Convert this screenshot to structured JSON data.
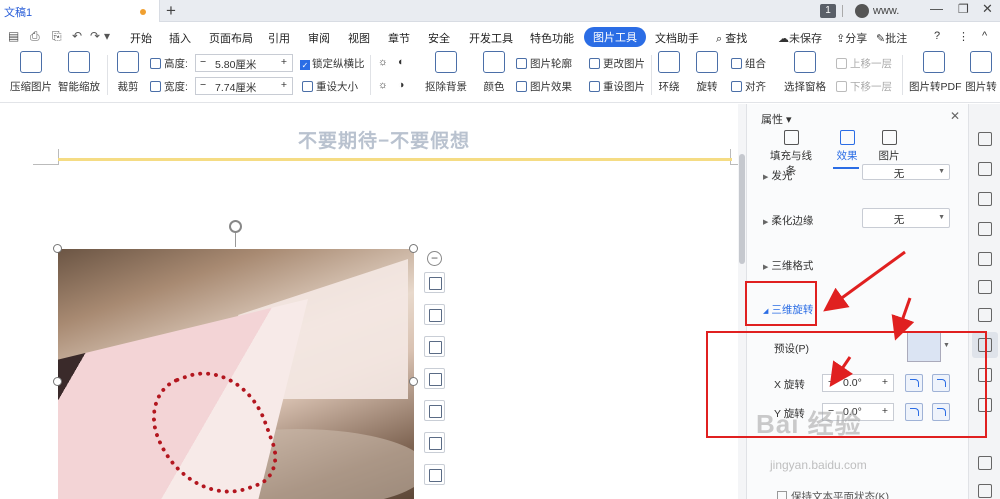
{
  "tabbar": {
    "doc_name": "文稿1",
    "new_tab": "+",
    "page_count": "1",
    "user_name": "www.",
    "win_min": "—",
    "win_max": "❐",
    "win_close": "✕"
  },
  "menubar": {
    "quick_access": [
      "▤",
      "⎙",
      "⎘",
      "↶",
      "↷",
      "▾"
    ],
    "items": [
      "开始",
      "插入",
      "页面布局",
      "引用",
      "审阅",
      "视图",
      "章节",
      "安全",
      "开发工具",
      "特色功能",
      "图片工具",
      "文档助手",
      "查找"
    ],
    "active_item": "图片工具",
    "right": {
      "unsaved": "未保存",
      "share": "分享",
      "comment": "批注",
      "help": "?",
      "more": "⋮",
      "collapse": "^"
    }
  },
  "ribbon": {
    "compress": "压缩图片",
    "smart_zoom": "智能缩放",
    "crop": "裁剪",
    "height_label": "高度:",
    "height_value": "5.80厘米",
    "width_label": "宽度:",
    "width_value": "7.74厘米",
    "lock_ratio": "锁定纵横比",
    "reset_size": "重设大小",
    "remove_bg": "抠除背景",
    "color": "颜色",
    "picture_outline": "图片轮廓",
    "picture_effect": "图片效果",
    "change_picture": "更改图片",
    "reset_picture": "重设图片",
    "wrap": "环绕",
    "rotate": "旋转",
    "group": "组合",
    "align": "对齐",
    "selection_pane": "选择窗格",
    "bring_forward": "上移一层",
    "send_backward": "下移一层",
    "to_pdf": "图片转PDF",
    "to_text": "图片转"
  },
  "document": {
    "header_text": "不要期待−不要假想"
  },
  "panel": {
    "title": "属性",
    "tabs": [
      "填充与线条",
      "效果",
      "图片"
    ],
    "active_tab": "效果",
    "glow_label": "发光",
    "glow_value": "无",
    "soft_edge_label": "柔化边缘",
    "soft_edge_value": "无",
    "three_d_format": "三维格式",
    "three_d_rotation": "三维旋转",
    "preset_label": "预设(P)",
    "x_label": "X 旋转",
    "x_value": "0.0°",
    "y_label": "Y 旋转",
    "y_value": "0.0°",
    "keep_flat": "保持文本平面状态(K)"
  },
  "watermark": {
    "text": "Bai 经验",
    "sub": "jingyan.baidu.com"
  },
  "colors": {
    "accent": "#2b6de5",
    "annotation": "#e02020",
    "header_line": "#f5dc84"
  },
  "icons": {
    "sidebar": [
      "pen-icon",
      "cursor-icon",
      "pin-icon",
      "shape-icon",
      "fill-icon",
      "grid-icon",
      "chart-icon",
      "settings-icon",
      "page-icon",
      "export-icon",
      "card-icon",
      "table-icon"
    ]
  }
}
